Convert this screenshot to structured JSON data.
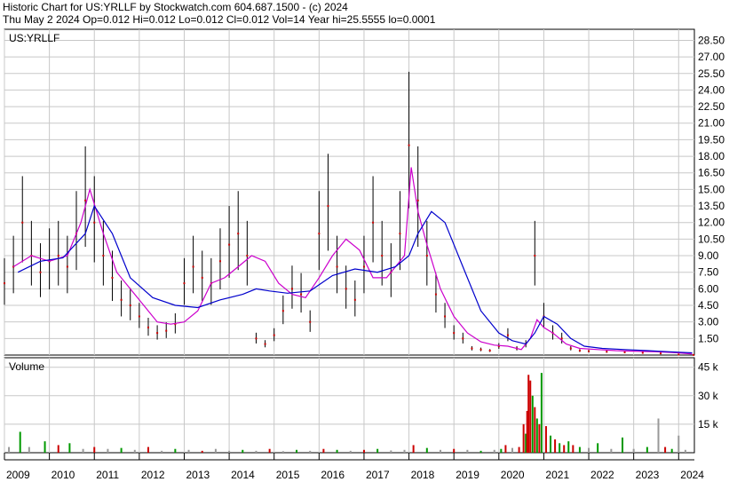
{
  "header": {
    "line1": "Historic Chart for US:YRLLF by Stockwatch.com 604.687.1500 - (c) 2024",
    "line2": "Thu May  2 2024   Op=0.012  Hi=0.012  Lo=0.012  Cl=0.012  Vol=14  Year hi=25.5555  lo=0.0001"
  },
  "colors": {
    "price_bar": "#000000",
    "close_dot": "#cc0000",
    "ma_short": "#cc00cc",
    "ma_long": "#0000cc",
    "vol_up": "#009900",
    "vol_down": "#cc0000",
    "vol_flat": "#999999",
    "grid": "#c8c8c8"
  },
  "chart_data": [
    {
      "type": "ohlc",
      "symbol_label": "US:YRLLF",
      "x_ticks": [
        "2009",
        "2010",
        "2011",
        "2012",
        "2013",
        "2014",
        "2015",
        "2016",
        "2017",
        "2018",
        "2019",
        "2020",
        "2021",
        "2022",
        "2023",
        "2024"
      ],
      "y_ticks": [
        "28.50",
        "27.00",
        "25.50",
        "24.00",
        "22.50",
        "21.00",
        "19.50",
        "18.00",
        "16.50",
        "15.00",
        "13.50",
        "12.00",
        "10.50",
        "9.00",
        "7.50",
        "6.00",
        "4.50",
        "3.00",
        "1.50"
      ],
      "ylim": [
        0,
        29.5
      ],
      "xlim": [
        2009.0,
        2024.35
      ],
      "series": [
        {
          "name": "",
          "style": "close",
          "x": [
            2009.0,
            2009.2,
            2009.4,
            2009.6,
            2009.8,
            2010.0,
            2010.2,
            2010.4,
            2010.6,
            2010.8,
            2011.0,
            2011.2,
            2011.4,
            2011.6,
            2011.8,
            2012.0,
            2012.2,
            2012.4,
            2012.6,
            2012.8,
            2013.0,
            2013.2,
            2013.4,
            2013.6,
            2013.8,
            2014.0,
            2014.2,
            2014.4,
            2014.6,
            2014.8,
            2015.0,
            2015.2,
            2015.4,
            2015.6,
            2015.8,
            2016.0,
            2016.2,
            2016.4,
            2016.6,
            2016.8,
            2017.0,
            2017.2,
            2017.4,
            2017.6,
            2017.8,
            2018.0,
            2018.2,
            2018.4,
            2018.6,
            2018.8,
            2019.0,
            2019.2,
            2019.4,
            2019.6,
            2019.8,
            2020.0,
            2020.2,
            2020.4,
            2020.6,
            2020.8,
            2021.0,
            2021.2,
            2021.4,
            2021.6,
            2021.8,
            2022.0,
            2022.4,
            2022.8,
            2023.2,
            2023.6,
            2024.0,
            2024.33
          ],
          "values": [
            6.5,
            8.0,
            12.0,
            9.0,
            7.5,
            8.5,
            9.0,
            8.0,
            11.0,
            14.0,
            12.0,
            9.0,
            7.0,
            5.0,
            4.5,
            3.5,
            2.5,
            2.0,
            2.2,
            2.8,
            6.5,
            8.0,
            7.0,
            6.5,
            8.5,
            10.0,
            11.0,
            9.0,
            1.5,
            1.0,
            1.8,
            4.0,
            6.0,
            5.5,
            3.0,
            11.0,
            13.5,
            8.0,
            6.0,
            5.0,
            8.0,
            12.0,
            9.0,
            7.5,
            11.0,
            19.0,
            14.0,
            9.0,
            5.5,
            3.5,
            2.0,
            1.5,
            0.6,
            0.5,
            0.4,
            0.8,
            1.8,
            0.6,
            1.0,
            9.0,
            3.5,
            2.0,
            1.5,
            0.6,
            0.4,
            0.35,
            0.3,
            0.25,
            0.2,
            0.15,
            0.05,
            0.012
          ]
        },
        {
          "name": "",
          "style": "ma_short",
          "x": [
            2009.2,
            2009.6,
            2010.0,
            2010.4,
            2010.7,
            2010.9,
            2011.2,
            2011.5,
            2011.8,
            2012.1,
            2012.4,
            2012.7,
            2013.0,
            2013.3,
            2013.6,
            2013.9,
            2014.2,
            2014.5,
            2014.8,
            2015.1,
            2015.4,
            2015.7,
            2016.0,
            2016.3,
            2016.6,
            2016.9,
            2017.2,
            2017.5,
            2017.7,
            2017.9,
            2018.05,
            2018.2,
            2018.4,
            2018.7,
            2019.0,
            2019.3,
            2019.6,
            2019.9,
            2020.2,
            2020.5,
            2020.7,
            2020.85,
            2021.0,
            2021.2,
            2021.5,
            2021.8,
            2022.2,
            2022.6,
            2023.0,
            2023.5,
            2024.0,
            2024.3
          ],
          "values": [
            8.0,
            9.0,
            8.5,
            9.0,
            12.0,
            15.0,
            11.0,
            7.5,
            6.0,
            4.5,
            3.0,
            2.8,
            3.0,
            4.0,
            6.5,
            7.0,
            8.0,
            9.0,
            8.5,
            6.5,
            5.5,
            5.2,
            7.0,
            9.0,
            10.5,
            9.5,
            7.0,
            7.0,
            8.0,
            9.0,
            17.0,
            13.0,
            10.0,
            6.0,
            3.5,
            2.0,
            1.2,
            0.9,
            0.8,
            0.5,
            1.5,
            3.2,
            2.5,
            2.0,
            1.0,
            0.6,
            0.5,
            0.4,
            0.35,
            0.3,
            0.2,
            0.1
          ]
        },
        {
          "name": "",
          "style": "ma_long",
          "x": [
            2009.3,
            2009.8,
            2010.3,
            2010.8,
            2011.0,
            2011.4,
            2011.8,
            2012.3,
            2012.8,
            2013.3,
            2013.8,
            2014.3,
            2014.6,
            2014.9,
            2015.3,
            2015.8,
            2016.3,
            2016.8,
            2017.3,
            2017.7,
            2018.0,
            2018.2,
            2018.5,
            2018.8,
            2019.2,
            2019.6,
            2020.0,
            2020.3,
            2020.6,
            2020.8,
            2021.0,
            2021.3,
            2021.6,
            2021.9,
            2022.3,
            2022.8,
            2023.3,
            2023.8,
            2024.3
          ],
          "values": [
            7.5,
            8.5,
            8.8,
            11.0,
            13.5,
            11.0,
            7.0,
            5.2,
            4.5,
            4.3,
            5.0,
            5.5,
            6.0,
            5.8,
            5.6,
            5.8,
            7.2,
            7.8,
            7.5,
            8.0,
            9.0,
            11.0,
            13.0,
            12.0,
            8.0,
            4.0,
            2.0,
            1.3,
            1.0,
            2.0,
            3.5,
            2.8,
            1.5,
            0.8,
            0.6,
            0.5,
            0.4,
            0.3,
            0.2
          ]
        }
      ]
    },
    {
      "type": "bar",
      "title": "Volume",
      "y_ticks": [
        "45 k",
        "30 k",
        "15 k"
      ],
      "ylim": [
        0,
        50000
      ],
      "x": [
        2009.1,
        2009.35,
        2009.55,
        2009.9,
        2010.2,
        2010.45,
        2010.75,
        2011.0,
        2011.3,
        2011.6,
        2011.9,
        2012.2,
        2012.5,
        2012.8,
        2013.1,
        2013.4,
        2013.7,
        2014.0,
        2014.3,
        2014.6,
        2014.9,
        2015.2,
        2015.5,
        2015.8,
        2016.1,
        2016.4,
        2016.7,
        2017.0,
        2017.3,
        2017.6,
        2017.9,
        2018.1,
        2018.4,
        2018.7,
        2019.0,
        2019.3,
        2019.6,
        2019.9,
        2020.05,
        2020.15,
        2020.3,
        2020.45,
        2020.55,
        2020.6,
        2020.63,
        2020.66,
        2020.7,
        2020.75,
        2020.8,
        2020.85,
        2020.9,
        2020.95,
        2021.05,
        2021.15,
        2021.25,
        2021.35,
        2021.45,
        2021.55,
        2021.65,
        2021.8,
        2022.0,
        2022.2,
        2022.5,
        2022.75,
        2023.0,
        2023.3,
        2023.55,
        2023.7,
        2023.85,
        2024.0,
        2024.15
      ],
      "values": [
        3000,
        11000,
        3000,
        6000,
        4000,
        5000,
        2000,
        3000,
        2000,
        2500,
        1500,
        3000,
        1000,
        2000,
        1500,
        1000,
        2000,
        1000,
        1500,
        1000,
        2000,
        800,
        1500,
        1000,
        2000,
        1500,
        1000,
        1500,
        2000,
        1200,
        1500,
        4000,
        2500,
        1500,
        2000,
        1500,
        1000,
        1500,
        2000,
        4000,
        2500,
        3000,
        15000,
        10000,
        22000,
        41000,
        38000,
        30000,
        24000,
        18000,
        15000,
        42000,
        14000,
        9000,
        7000,
        5000,
        4000,
        6000,
        4000,
        3000,
        2500,
        5000,
        2000,
        8000,
        2000,
        3000,
        18000,
        3000,
        2000,
        9000,
        1500
      ],
      "colors": [
        "flat",
        "up",
        "flat",
        "up",
        "down",
        "up",
        "flat",
        "down",
        "flat",
        "up",
        "flat",
        "down",
        "flat",
        "up",
        "flat",
        "down",
        "flat",
        "flat",
        "up",
        "flat",
        "down",
        "flat",
        "up",
        "flat",
        "down",
        "up",
        "flat",
        "down",
        "up",
        "flat",
        "flat",
        "down",
        "up",
        "flat",
        "down",
        "flat",
        "up",
        "flat",
        "up",
        "down",
        "flat",
        "down",
        "down",
        "up",
        "down",
        "down",
        "down",
        "up",
        "down",
        "up",
        "down",
        "up",
        "down",
        "up",
        "down",
        "up",
        "down",
        "up",
        "down",
        "up",
        "flat",
        "up",
        "flat",
        "up",
        "flat",
        "up",
        "flat",
        "down",
        "up",
        "flat",
        "flat"
      ]
    }
  ]
}
